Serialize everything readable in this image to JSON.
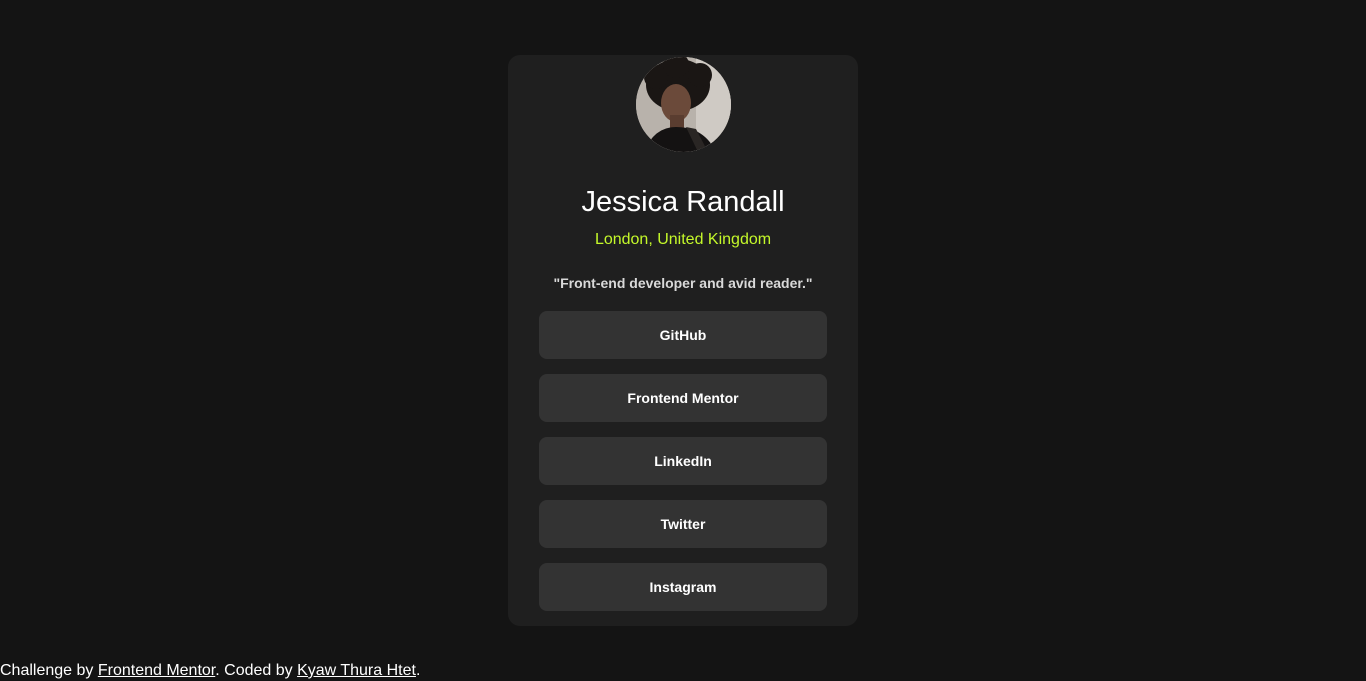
{
  "profile": {
    "avatar": "avatar-jessica",
    "name": "Jessica Randall",
    "location": "London, United Kingdom",
    "bio": "\"Front-end developer and avid reader.\""
  },
  "links": [
    {
      "label": "GitHub"
    },
    {
      "label": "Frontend Mentor"
    },
    {
      "label": "LinkedIn"
    },
    {
      "label": "Twitter"
    },
    {
      "label": "Instagram"
    }
  ],
  "attribution": {
    "prefix": "Challenge by ",
    "challenge_link": "Frontend Mentor",
    "middle": ". Coded by ",
    "author_link": "Kyaw Thura Htet",
    "suffix": "."
  },
  "colors": {
    "background": "#141414",
    "card": "#1f1f1f",
    "button": "#333333",
    "accent": "#c4f82a",
    "text": "#ffffff"
  }
}
